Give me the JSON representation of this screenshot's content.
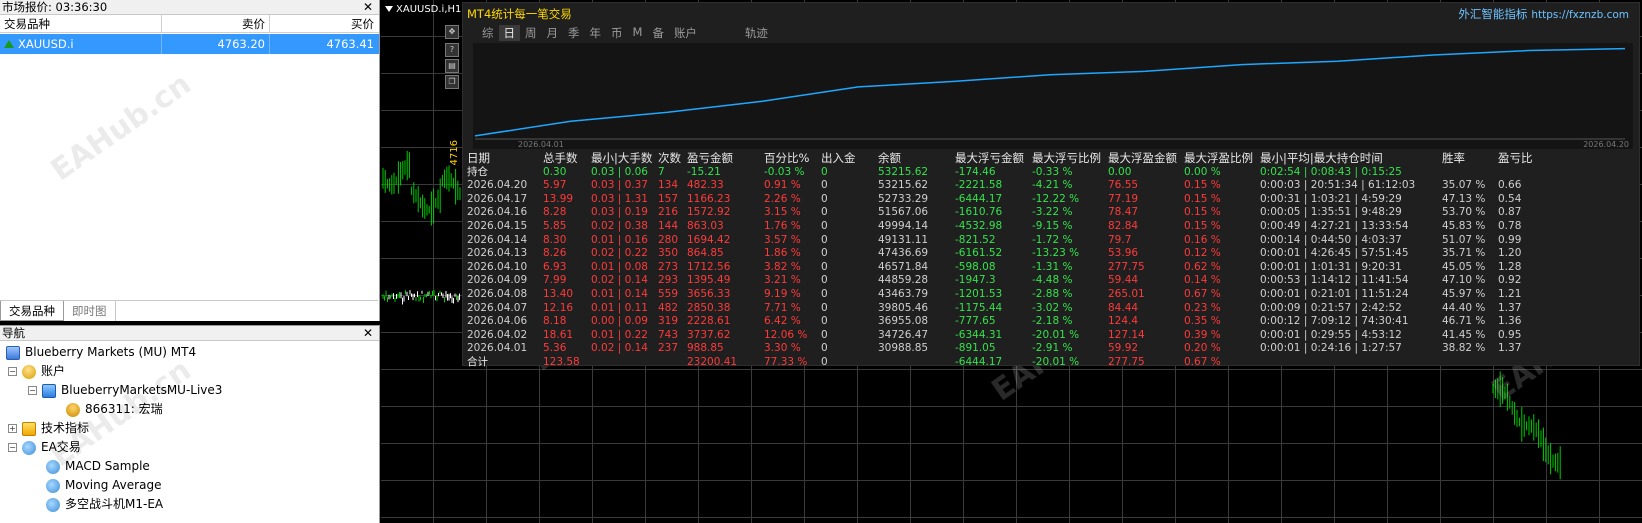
{
  "market_watch": {
    "title": "市场报价: 03:36:30",
    "columns": [
      "交易品种",
      "卖价",
      "买价"
    ],
    "rows": [
      {
        "symbol": "XAUUSD.i",
        "bid": "4763.20",
        "ask": "4763.41"
      }
    ],
    "tabs": [
      "交易品种",
      "即时图"
    ]
  },
  "navigator": {
    "title": "导航",
    "items": [
      {
        "label": "Blueberry Markets (MU) MT4",
        "icon": "terminal-icon"
      },
      {
        "label": "账户",
        "icon": "accounts-icon"
      },
      {
        "label": "BlueberryMarketsMU-Live3",
        "icon": "server-icon"
      },
      {
        "label": "866311: 宏瑞",
        "icon": "user-icon"
      },
      {
        "label": "技术指标",
        "icon": "indicator-icon"
      },
      {
        "label": "EA交易",
        "icon": "expert-icon"
      },
      {
        "label": "MACD Sample",
        "icon": "expert-icon"
      },
      {
        "label": "Moving Average",
        "icon": "expert-icon"
      },
      {
        "label": "多空战斗机M1-EA",
        "icon": "expert-icon"
      }
    ]
  },
  "chart": {
    "title": "XAUUSD.i,H1",
    "price_tag": "4716",
    "watermark": "EAHub.cn"
  },
  "indicator": {
    "title": "MT4统计每一笔交易",
    "brand": "外汇智能指标",
    "brand_url": "https://fxznzb.com",
    "tabs": [
      "综",
      "日",
      "周",
      "月",
      "季",
      "年",
      "币",
      "M",
      "备",
      "账户",
      "轨迹"
    ],
    "selected_tab": "日",
    "curve": {
      "start_label": "2026.04.01",
      "end_label": "2026.04.20",
      "color": "#1ea7ff"
    },
    "columns": [
      "日期",
      "总手数",
      "最小|大手数",
      "次数",
      "盈亏金额",
      "百分比%",
      "出入金",
      "余额",
      "最大浮亏金额",
      "最大浮亏比例",
      "最大浮盈金额",
      "最大浮盈比例",
      "最小|平均|最大持仓时间",
      "胜率",
      "盈亏比"
    ],
    "holding": {
      "d": "持仓",
      "lots": "0.30",
      "minmax": "0.03 | 0.06",
      "n": "7",
      "pl": "-15.21",
      "pct": "-0.03 %",
      "io": "0",
      "bal": "53215.62",
      "mfl": "-174.46",
      "mflp": "-0.33 %",
      "mfg": "0.00",
      "mfgp": "0.00 %",
      "time": "0:02:54 | 0:08:43 | 0:15:25",
      "win": "",
      "plr": ""
    },
    "rows": [
      {
        "d": "2026.04.20",
        "lots": "5.97",
        "minmax": "0.03 | 0.37",
        "n": "134",
        "pl": "482.33",
        "pct": "0.91 %",
        "io": "0",
        "bal": "53215.62",
        "mfl": "-2221.58",
        "mflp": "-4.21 %",
        "mfg": "76.55",
        "mfgp": "0.15 %",
        "time": "0:00:03 | 20:51:34 | 61:12:03",
        "win": "35.07 %",
        "plr": "0.66"
      },
      {
        "d": "2026.04.17",
        "lots": "13.99",
        "minmax": "0.03 | 1.31",
        "n": "157",
        "pl": "1166.23",
        "pct": "2.26 %",
        "io": "0",
        "bal": "52733.29",
        "mfl": "-6444.17",
        "mflp": "-12.22 %",
        "mfg": "77.19",
        "mfgp": "0.15 %",
        "time": "0:00:31 | 1:03:21 | 4:59:29",
        "win": "47.13 %",
        "plr": "0.54"
      },
      {
        "d": "2026.04.16",
        "lots": "8.28",
        "minmax": "0.03 | 0.19",
        "n": "216",
        "pl": "1572.92",
        "pct": "3.15 %",
        "io": "0",
        "bal": "51567.06",
        "mfl": "-1610.76",
        "mflp": "-3.22 %",
        "mfg": "78.47",
        "mfgp": "0.15 %",
        "time": "0:00:05 | 1:35:51 | 9:48:29",
        "win": "53.70 %",
        "plr": "0.87"
      },
      {
        "d": "2026.04.15",
        "lots": "5.85",
        "minmax": "0.02 | 0.38",
        "n": "144",
        "pl": "863.03",
        "pct": "1.76 %",
        "io": "0",
        "bal": "49994.14",
        "mfl": "-4532.98",
        "mflp": "-9.15 %",
        "mfg": "82.84",
        "mfgp": "0.15 %",
        "time": "0:00:49 | 4:27:21 | 13:33:54",
        "win": "45.83 %",
        "plr": "0.78"
      },
      {
        "d": "2026.04.14",
        "lots": "8.30",
        "minmax": "0.01 | 0.16",
        "n": "280",
        "pl": "1694.42",
        "pct": "3.57 %",
        "io": "0",
        "bal": "49131.11",
        "mfl": "-821.52",
        "mflp": "-1.72 %",
        "mfg": "79.7",
        "mfgp": "0.16 %",
        "time": "0:00:14 | 0:44:50 | 4:03:37",
        "win": "51.07 %",
        "plr": "0.99"
      },
      {
        "d": "2026.04.13",
        "lots": "8.26",
        "minmax": "0.02 | 0.22",
        "n": "350",
        "pl": "864.85",
        "pct": "1.86 %",
        "io": "0",
        "bal": "47436.69",
        "mfl": "-6161.52",
        "mflp": "-13.23 %",
        "mfg": "53.96",
        "mfgp": "0.12 %",
        "time": "0:00:01 | 4:26:45 | 57:51:45",
        "win": "35.71 %",
        "plr": "1.20"
      },
      {
        "d": "2026.04.10",
        "lots": "6.93",
        "minmax": "0.01 | 0.08",
        "n": "273",
        "pl": "1712.56",
        "pct": "3.82 %",
        "io": "0",
        "bal": "46571.84",
        "mfl": "-598.08",
        "mflp": "-1.31 %",
        "mfg": "277.75",
        "mfgp": "0.62 %",
        "time": "0:00:01 | 1:01:31 | 9:20:31",
        "win": "45.05 %",
        "plr": "1.28"
      },
      {
        "d": "2026.04.09",
        "lots": "7.99",
        "minmax": "0.02 | 0.14",
        "n": "293",
        "pl": "1395.49",
        "pct": "3.21 %",
        "io": "0",
        "bal": "44859.28",
        "mfl": "-1947.3",
        "mflp": "-4.48 %",
        "mfg": "59.44",
        "mfgp": "0.14 %",
        "time": "0:00:53 | 1:14:12 | 11:41:54",
        "win": "47.10 %",
        "plr": "0.92"
      },
      {
        "d": "2026.04.08",
        "lots": "13.40",
        "minmax": "0.01 | 0.14",
        "n": "559",
        "pl": "3656.33",
        "pct": "9.19 %",
        "io": "0",
        "bal": "43463.79",
        "mfl": "-1201.53",
        "mflp": "-2.88 %",
        "mfg": "265.01",
        "mfgp": "0.67 %",
        "time": "0:00:01 | 0:21:01 | 11:51:24",
        "win": "45.97 %",
        "plr": "1.21"
      },
      {
        "d": "2026.04.07",
        "lots": "12.16",
        "minmax": "0.01 | 0.11",
        "n": "482",
        "pl": "2850.38",
        "pct": "7.71 %",
        "io": "0",
        "bal": "39805.46",
        "mfl": "-1175.44",
        "mflp": "-3.02 %",
        "mfg": "84.44",
        "mfgp": "0.23 %",
        "time": "0:00:09 | 0:21:57 | 2:42:52",
        "win": "44.40 %",
        "plr": "1.37"
      },
      {
        "d": "2026.04.06",
        "lots": "8.18",
        "minmax": "0.00 | 0.09",
        "n": "319",
        "pl": "2228.61",
        "pct": "6.42 %",
        "io": "0",
        "bal": "36955.08",
        "mfl": "-777.65",
        "mflp": "-2.18 %",
        "mfg": "124.4",
        "mfgp": "0.35 %",
        "time": "0:00:12 | 7:09:12 | 74:30:41",
        "win": "46.71 %",
        "plr": "1.36"
      },
      {
        "d": "2026.04.02",
        "lots": "18.61",
        "minmax": "0.01 | 0.22",
        "n": "743",
        "pl": "3737.62",
        "pct": "12.06 %",
        "io": "0",
        "bal": "34726.47",
        "mfl": "-6344.31",
        "mflp": "-20.01 %",
        "mfg": "127.14",
        "mfgp": "0.39 %",
        "time": "0:00:01 | 0:29:55 | 4:53:12",
        "win": "41.45 %",
        "plr": "0.95"
      },
      {
        "d": "2026.04.01",
        "lots": "5.36",
        "minmax": "0.02 | 0.14",
        "n": "237",
        "pl": "988.85",
        "pct": "3.30 %",
        "io": "0",
        "bal": "30988.85",
        "mfl": "-891.05",
        "mflp": "-2.91 %",
        "mfg": "59.92",
        "mfgp": "0.20 %",
        "time": "0:00:01 | 0:24:16 | 1:27:57",
        "win": "38.82 %",
        "plr": "1.37"
      }
    ],
    "total": {
      "d": "合计",
      "lots": "123.58",
      "minmax": "",
      "n": "",
      "pl": "23200.41",
      "pct": "77.33 %",
      "io": "0",
      "bal": "",
      "mfl": "-6444.17",
      "mflp": "-20.01 %",
      "mfg": "277.75",
      "mfgp": "0.67 %",
      "time": "",
      "win": "",
      "plr": ""
    },
    "equity_curve": [
      30988.85,
      34726.47,
      36955.08,
      39805.46,
      43463.79,
      44859.28,
      46571.84,
      47436.69,
      49131.11,
      49994.14,
      51567.06,
      52733.29,
      53215.62
    ]
  }
}
